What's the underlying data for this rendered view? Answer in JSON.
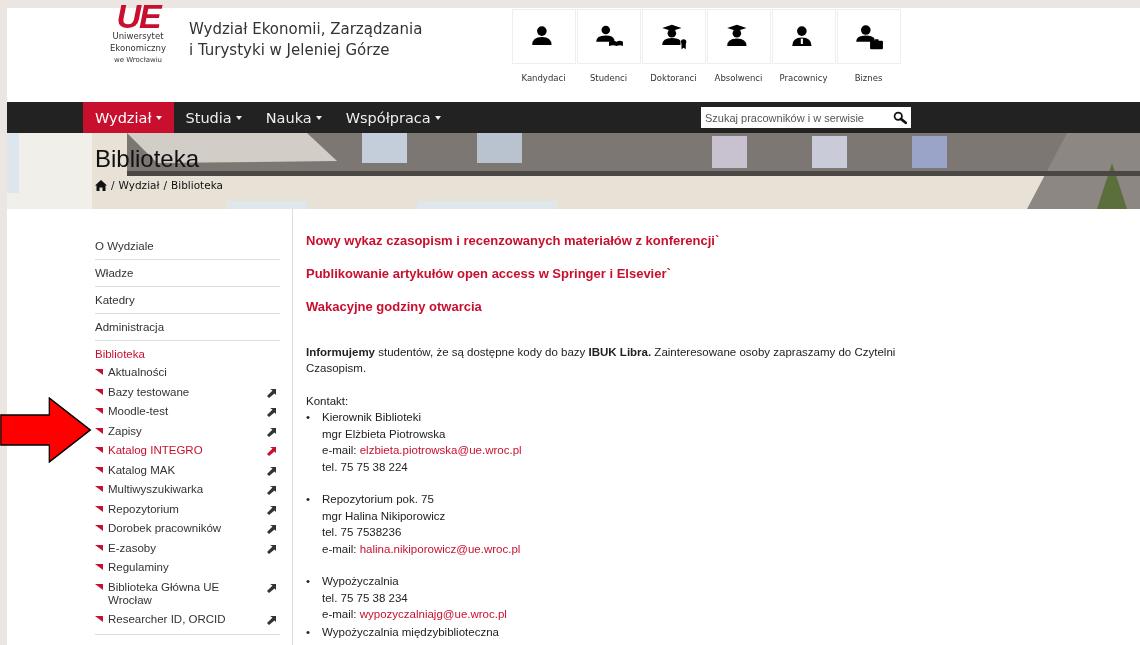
{
  "header": {
    "logo": {
      "letters": "UE",
      "lines": [
        "Uniwersytet",
        "Ekonomiczny",
        "we Wrocławiu"
      ]
    },
    "faculty": [
      "Wydział Ekonomii, Zarządzania",
      "i Turystyki w Jeleniej Górze"
    ],
    "audiences": [
      {
        "label": "Kandydaci"
      },
      {
        "label": "Studenci"
      },
      {
        "label": "Doktoranci"
      },
      {
        "label": "Absolwenci"
      },
      {
        "label": "Pracownicy"
      },
      {
        "label": "Biznes"
      }
    ]
  },
  "nav": {
    "items": [
      {
        "label": "Wydział",
        "selected": true
      },
      {
        "label": "Studia",
        "selected": false
      },
      {
        "label": "Nauka",
        "selected": false
      },
      {
        "label": "Współpraca",
        "selected": false
      }
    ],
    "search": {
      "placeholder": "Szukaj pracowników i w serwisie"
    }
  },
  "banner": {
    "title": "Biblioteka",
    "breadcrumb": [
      {
        "separator": "/",
        "label": "Wydział"
      },
      {
        "separator": "/",
        "label": "Biblioteka"
      }
    ]
  },
  "sidebar": {
    "items": [
      {
        "label": "O Wydziale",
        "selected": false
      },
      {
        "label": "Władze",
        "selected": false
      },
      {
        "label": "Katedry",
        "selected": false
      },
      {
        "label": "Administracja",
        "selected": false
      },
      {
        "label": "Biblioteka",
        "selected": true,
        "children": [
          {
            "label": "Aktualności",
            "selected": false,
            "external": false
          },
          {
            "label": "Bazy testowane",
            "selected": false,
            "external": true
          },
          {
            "label": "Moodle-test",
            "selected": false,
            "external": true
          },
          {
            "label": "Zapisy",
            "selected": false,
            "external": true
          },
          {
            "label": "Katalog INTEGRO",
            "selected": true,
            "external": true
          },
          {
            "label": "Katalog MAK",
            "selected": false,
            "external": true
          },
          {
            "label": "Multiwyszukiwarka",
            "selected": false,
            "external": true
          },
          {
            "label": "Repozytorium",
            "selected": false,
            "external": true
          },
          {
            "label": "Dorobek pracowników",
            "selected": false,
            "external": true
          },
          {
            "label": "E-zasoby",
            "selected": false,
            "external": true
          },
          {
            "label": "Regulaminy",
            "selected": false,
            "external": false
          },
          {
            "label": "Biblioteka Główna UE Wrocław",
            "selected": false,
            "external": true
          },
          {
            "label": "Researcher ID, ORCID",
            "selected": false,
            "external": true
          }
        ]
      }
    ]
  },
  "content": {
    "news": [
      "Nowy wykaz czasopism i  recenzowanych materiałów z konferencji`",
      "Publikowanie artykułów open access w Springer i Elsevier`",
      "Wakacyjne godziny otwarcia"
    ],
    "intro": "**Informujemy** studentów, że są dostępne kody do bazy **IBUK Libra.** Zainteresowane osoby zapraszamy do Czytelni Czasopism.",
    "contact_label": "Kontakt:",
    "contacts": [
      {
        "bullet": "•",
        "lines": [
          {
            "text": "Kierownik Biblioteki"
          },
          {
            "text": "mgr Elżbieta Piotrowska"
          },
          {
            "text": "e-mail:",
            "link": "elzbieta.piotrowska@ue.wroc.pl"
          },
          {
            "text": "tel. 75 75 38 224"
          }
        ]
      },
      {
        "bullet": "•",
        "lines": [
          {
            "text": "Repozytorium  pok. 75"
          },
          {
            "text": "mgr Halina Nikiporowicz"
          },
          {
            "text": "tel. 75 7538236"
          },
          {
            "text": "e-mail:",
            "link": "halina.nikiporowicz@ue.wroc.pl"
          }
        ]
      },
      {
        "bullet": "•",
        "lines": [
          {
            "text": "Wypożyczalnia"
          },
          {
            "text": "tel. 75 75 38 234"
          },
          {
            "text": "e-mail:",
            "link": "wypozyczalniajg@ue.wroc.pl"
          }
        ]
      },
      {
        "bullet": "•",
        "lines": [
          {
            "text": "Wypożyczalnia międzybiblioteczna"
          }
        ]
      }
    ]
  }
}
